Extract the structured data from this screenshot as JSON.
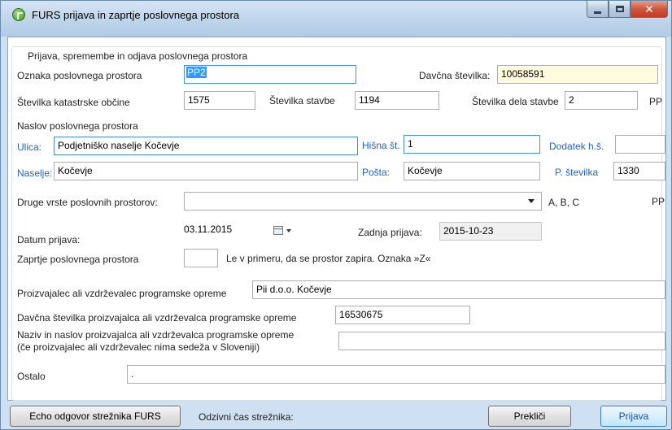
{
  "window": {
    "title": "FURS prijava in zaprtje poslovnega prostora"
  },
  "group": {
    "title": "Prijava, spremembe in odjava poslovnega prostora"
  },
  "fields": {
    "oznaka_label": "Oznaka poslovnega prostora",
    "oznaka_value": "PP2",
    "davcna_label": "Davčna številka:",
    "davcna_value": "10058591",
    "katastrska_label": "Številka katastrske občine",
    "katastrska_value": "1575",
    "stavba_label": "Številka stavbe",
    "stavba_value": "1194",
    "del_stavbe_label": "Številka dela stavbe",
    "del_stavbe_value": "2",
    "pp_label": "PP",
    "naslov_label": "Naslov poslovnega prostora",
    "ulica_label": "Ulica:",
    "ulica_value": "Podjetniško naselje Kočevje",
    "hisna_label": "Hišna št.",
    "hisna_value": "1",
    "dodatek_label": "Dodatek h.š.",
    "dodatek_value": "",
    "naselje_label": "Naselje:",
    "naselje_value": "Kočevje",
    "posta_label": "Pošta:",
    "posta_value": "Kočevje",
    "pstevilka_label": "P. številka",
    "pstevilka_value": "1330",
    "druge_label": "Druge vrste poslovnih prostorov:",
    "druge_value": "",
    "abc_label": "A, B, C",
    "pp2_label": "PP",
    "datum_label": "Datum prijava:",
    "datum_value": "03.11.2015",
    "zadnja_label": "Zadnja prijava:",
    "zadnja_value": "2015-10-23",
    "zaprtje_label": "Zaprtje poslovnega prostora",
    "zaprtje_value": "",
    "zaprtje_note": "Le v primeru, da se prostor zapira. Oznaka »Z«",
    "proizvajalec_label": "Proizvajalec ali vzdrževalec programske opreme",
    "proizvajalec_value": "Pii d.o.o. Kočevje",
    "davcna_proizv_label": "Davčna številka proizvajalca ali vzdrževalca programske opreme",
    "davcna_proizv_value": "16530675",
    "naziv_label_1": "Naziv in naslov proizvajalca ali vzdrževalca programske opreme",
    "naziv_label_2": "(če proizvajalec ali vzdrževalec nima sedeža v Sloveniji)",
    "naziv_value": "",
    "ostalo_label": "Ostalo",
    "ostalo_value": "."
  },
  "status": {
    "echo_button": "Echo odgovor strežnika FURS",
    "odzivni_label": "Odzivni čas strežnika:",
    "preklici_button": "Prekliči",
    "prijava_button": "Prijava"
  }
}
